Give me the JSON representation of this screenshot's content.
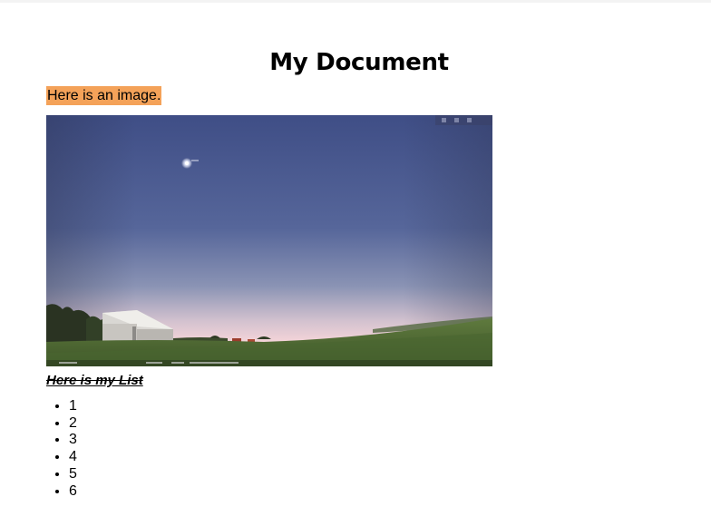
{
  "document": {
    "title": "My Document",
    "intro_text": "Here is an image.",
    "intro_highlight_color": "#f4a259",
    "image": {
      "kind": "sky-panorama",
      "sky_top_color": "#3f4e86",
      "sky_horizon_color": "#f3d3d8",
      "ground_color": "#4f6b34",
      "building_color": "#d9d7d3"
    },
    "list_title": "Here is my List",
    "list_items": [
      "1",
      "2",
      "3",
      "4",
      "5",
      "6"
    ]
  }
}
